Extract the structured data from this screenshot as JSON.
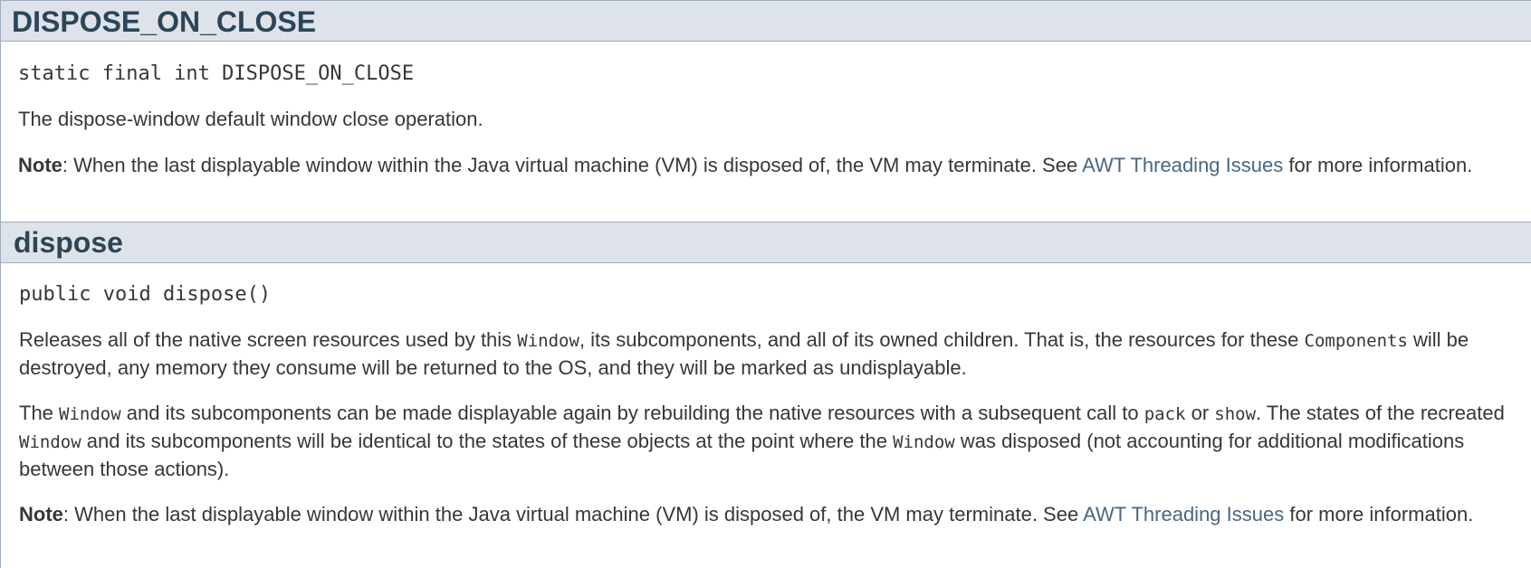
{
  "field_section": {
    "heading": "DISPOSE_ON_CLOSE",
    "signature": "static final int DISPOSE_ON_CLOSE",
    "description": "The dispose-window default window close operation.",
    "note": {
      "label": "Note",
      "text_before_link": ": When the last displayable window within the Java virtual machine (VM) is disposed of, the VM may terminate. See ",
      "link_text": "AWT Threading Issues",
      "text_after_link": " for more information."
    }
  },
  "method_section": {
    "heading": "dispose",
    "signature": "public void dispose()",
    "paragraph1": {
      "t1": "Releases all of the native screen resources used by this ",
      "c1": "Window",
      "t2": ", its subcomponents, and all of its owned children. That is, the resources for these ",
      "c2": "Components",
      "t3": " will be destroyed, any memory they consume will be returned to the OS, and they will be marked as undisplayable."
    },
    "paragraph2": {
      "t1": "The ",
      "c1": "Window",
      "t2": " and its subcomponents can be made displayable again by rebuilding the native resources with a subsequent call to ",
      "c2": "pack",
      "t3": " or ",
      "c3": "show",
      "t4": ". The states of the recreated ",
      "c4": "Window",
      "t5": " and its subcomponents will be identical to the states of these objects at the point where the ",
      "c5": "Window",
      "t6": " was disposed (not accounting for additional modifications between those actions)."
    },
    "note": {
      "label": "Note",
      "text_before_link": ": When the last displayable window within the Java virtual machine (VM) is disposed of, the VM may terminate. See ",
      "link_text": "AWT Threading Issues",
      "text_after_link": " for more information."
    }
  },
  "colors": {
    "heading_background": "#dee3e9",
    "heading_text": "#2c4557",
    "body_text": "#353833",
    "link": "#4a6782",
    "border": "#9eadc0"
  }
}
